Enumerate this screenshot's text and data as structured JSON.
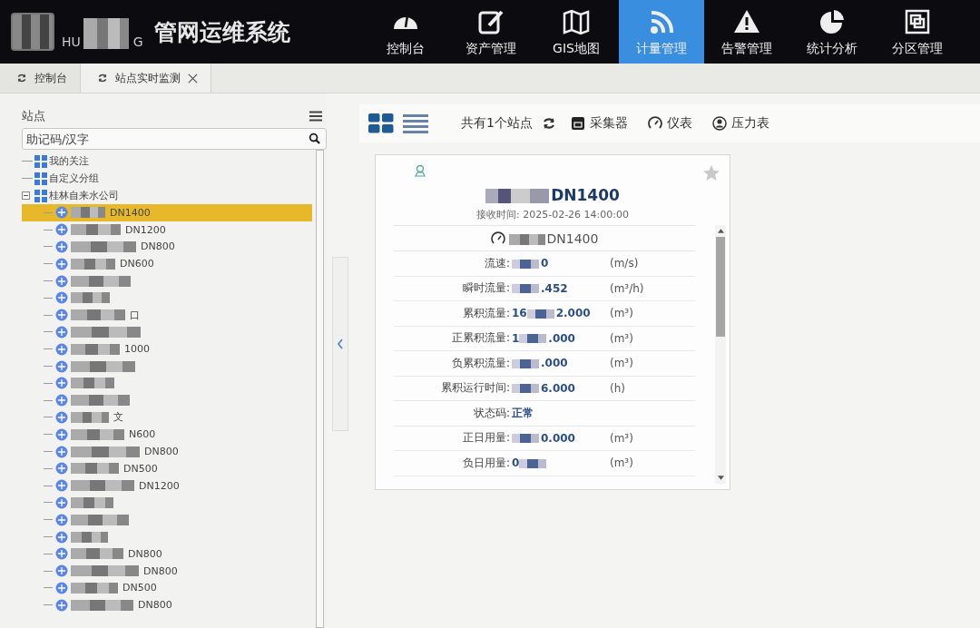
{
  "header": {
    "logo_letters": [
      "HU",
      "G"
    ],
    "title": "管网运维系统"
  },
  "nav": [
    {
      "label": "控制台",
      "kind": "gauge",
      "selected": false
    },
    {
      "label": "资产管理",
      "kind": "edit",
      "selected": false
    },
    {
      "label": "GIS地图",
      "kind": "map",
      "selected": false
    },
    {
      "label": "计量管理",
      "kind": "signal",
      "selected": true
    },
    {
      "label": "告警管理",
      "kind": "warning",
      "selected": false
    },
    {
      "label": "统计分析",
      "kind": "pie",
      "selected": false
    },
    {
      "label": "分区管理",
      "kind": "region",
      "selected": false
    }
  ],
  "tabs": [
    {
      "label": "控制台",
      "closable": false,
      "selected": false
    },
    {
      "label": "站点实时监测",
      "closable": true,
      "selected": true
    }
  ],
  "sidebar": {
    "title": "站点",
    "search": {
      "placeholder": "助记码/汉字"
    },
    "groups": [
      {
        "label": "我的关注",
        "expanded": false
      },
      {
        "label": "自定义分组",
        "expanded": false
      },
      {
        "label": "桂林自来水公司",
        "expanded": true,
        "children": [
          {
            "text": "DN1400",
            "selected": true
          },
          {
            "text": "DN1200",
            "selected": false
          },
          {
            "text": "DN800",
            "selected": false
          },
          {
            "text": "DN600",
            "selected": false
          },
          {
            "selected": false
          },
          {
            "selected": false
          },
          {
            "text": "口",
            "selected": false
          },
          {
            "selected": false
          },
          {
            "text": "1000",
            "selected": false
          },
          {
            "selected": false
          },
          {
            "selected": false
          },
          {
            "selected": false
          },
          {
            "text": "文",
            "selected": false
          },
          {
            "text": "N600",
            "selected": false
          },
          {
            "text": "DN800",
            "selected": false
          },
          {
            "text": "DN500",
            "selected": false
          },
          {
            "text": "DN1200",
            "selected": false
          },
          {
            "selected": false
          },
          {
            "selected": false
          },
          {
            "selected": false
          },
          {
            "text": "DN800",
            "selected": false
          },
          {
            "text": "DN800",
            "selected": false
          },
          {
            "text": "DN500",
            "selected": false
          },
          {
            "text": "DN800",
            "selected": false
          }
        ]
      }
    ]
  },
  "toolbar": {
    "views": [
      {
        "kind": "grid",
        "selected": true
      },
      {
        "kind": "list",
        "selected": false
      }
    ],
    "count": "共有1个站点",
    "filters": [
      {
        "kind": "collector",
        "label": "采集器"
      },
      {
        "kind": "meter",
        "label": "仪表"
      },
      {
        "kind": "pressure",
        "label": "压力表"
      }
    ]
  },
  "card": {
    "title": "DN1400",
    "received": "接收时间: 2025-02-26 14:00:00",
    "meter": "DN1400",
    "rows": [
      {
        "label": "流速:",
        "value": "0",
        "unit": "(m/s)",
        "redacted": true
      },
      {
        "label": "瞬时流量:",
        "value": ".452",
        "unit": "(m³/h)",
        "redacted": true
      },
      {
        "label": "累积流量:",
        "prefix": "16",
        "value": "2.000",
        "unit": "(m³)",
        "redacted": true
      },
      {
        "label": "正累积流量:",
        "prefix": "1",
        "value": ".000",
        "unit": "(m³)",
        "redacted": true
      },
      {
        "label": "负累积流量:",
        "value": ".000",
        "unit": "(m³)",
        "redacted": true
      },
      {
        "label": "累积运行时间:",
        "value": "6.000",
        "unit": "(h)",
        "redacted": true
      },
      {
        "label": "状态码:",
        "value": "正常",
        "redacted": false
      },
      {
        "label": "正日用量:",
        "value": "0.000",
        "unit": "(m³)",
        "redacted": true
      },
      {
        "label": "负日用量:",
        "prefix": "0",
        "unit": "(m³)",
        "redacted": true
      }
    ]
  }
}
